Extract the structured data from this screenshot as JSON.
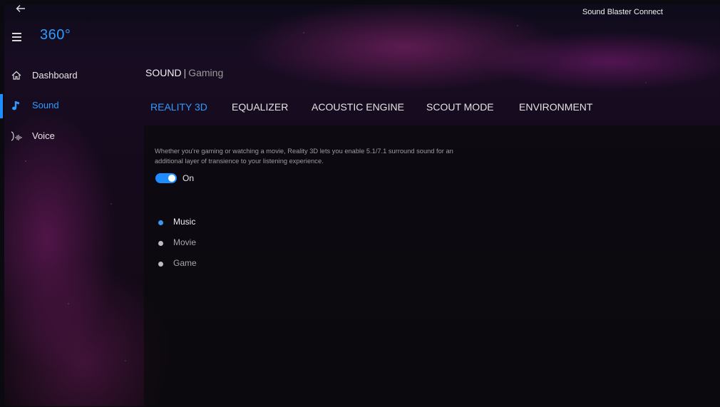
{
  "window": {
    "title": "Sound Blaster Connect"
  },
  "header": {
    "back_icon": "back-arrow-icon",
    "menu_icon": "hamburger-icon",
    "product": "360°"
  },
  "sidebar": {
    "items": [
      {
        "label": "Dashboard",
        "icon": "home-icon",
        "active": false
      },
      {
        "label": "Sound",
        "icon": "music-note-icon",
        "active": true
      },
      {
        "label": "Voice",
        "icon": "voice-wave-icon",
        "active": false
      }
    ]
  },
  "breadcrumb": {
    "section": "SOUND",
    "separator": "|",
    "profile": "Gaming"
  },
  "tabs": [
    {
      "label": "REALITY 3D",
      "active": true
    },
    {
      "label": "EQUALIZER",
      "active": false
    },
    {
      "label": "ACOUSTIC ENGINE",
      "active": false
    },
    {
      "label": "SCOUT MODE",
      "active": false
    },
    {
      "label": "ENVIRONMENT",
      "active": false
    }
  ],
  "reality3d": {
    "description_line1": "Whether you're gaming or watching a movie, Reality 3D lets you enable 5.1/7.1 surround sound for an",
    "description_line2": "additional layer of transience to your listening experience.",
    "toggle_label": "On",
    "toggle_on": true,
    "modes": [
      {
        "label": "Music",
        "selected": true
      },
      {
        "label": "Movie",
        "selected": false
      },
      {
        "label": "Game",
        "selected": false
      }
    ]
  },
  "colors": {
    "accent": "#2f9bff",
    "background": "#120912",
    "text": "#e8e8e8"
  }
}
